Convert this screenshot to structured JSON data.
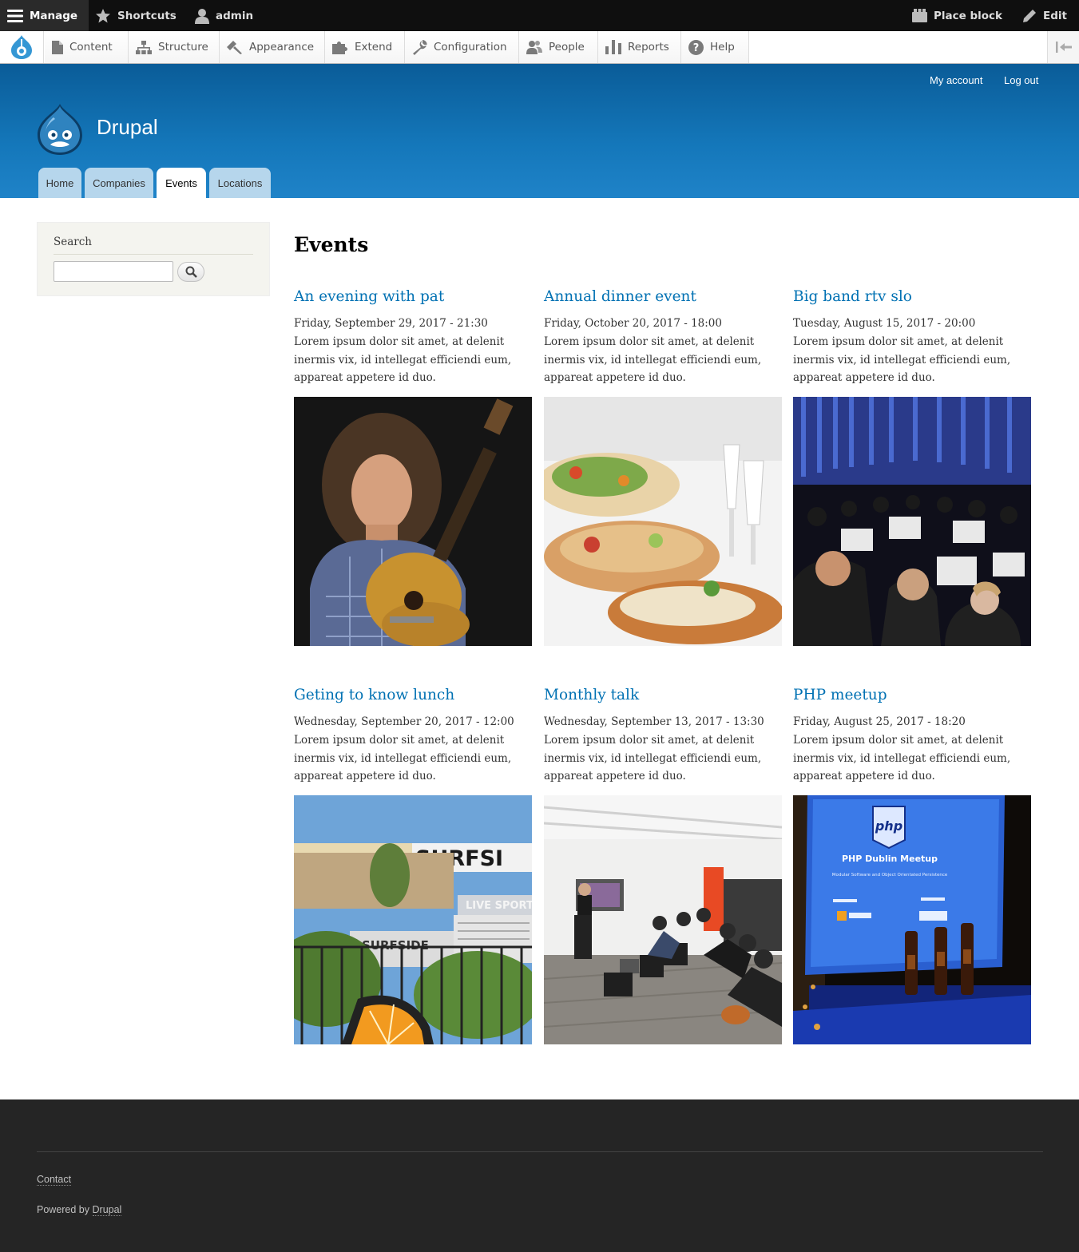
{
  "toolbar": {
    "manage": "Manage",
    "shortcuts": "Shortcuts",
    "user": "admin",
    "place_block": "Place block",
    "edit": "Edit"
  },
  "tray": {
    "items": [
      {
        "label": "Content",
        "icon": "file-icon"
      },
      {
        "label": "Structure",
        "icon": "sitemap-icon"
      },
      {
        "label": "Appearance",
        "icon": "brush-icon"
      },
      {
        "label": "Extend",
        "icon": "puzzle-icon"
      },
      {
        "label": "Configuration",
        "icon": "wrench-icon"
      },
      {
        "label": "People",
        "icon": "people-icon"
      },
      {
        "label": "Reports",
        "icon": "bar-chart-icon"
      },
      {
        "label": "Help",
        "icon": "help-icon"
      }
    ]
  },
  "header": {
    "secondary_menu": [
      "My account",
      "Log out"
    ],
    "site_name": "Drupal",
    "tabs": [
      "Home",
      "Companies",
      "Events",
      "Locations"
    ],
    "active_tab": "Events"
  },
  "sidebar": {
    "search_title": "Search",
    "search_value": ""
  },
  "main": {
    "title": "Events",
    "events": [
      {
        "title": "An evening with pat",
        "date": "Friday, September 29, 2017 - 21:30",
        "body": "Lorem ipsum dolor sit amet, at delenit inermis vix, id intellegat efficiendi eum, appareat appetere id duo.",
        "image": "guitarist-photo"
      },
      {
        "title": "Annual dinner event",
        "date": "Friday, October 20, 2017 - 18:00",
        "body": "Lorem ipsum dolor sit amet, at delenit inermis vix, id intellegat efficiendi eum, appareat appetere id duo.",
        "image": "banquet-photo"
      },
      {
        "title": "Big band rtv slo",
        "date": "Tuesday, August 15, 2017 - 20:00",
        "body": "Lorem ipsum dolor sit amet, at delenit inermis vix, id intellegat efficiendi eum, appareat appetere id duo.",
        "image": "orchestra-photo"
      },
      {
        "title": "Geting to know lunch",
        "date": "Wednesday, September 20, 2017 - 12:00",
        "body": "Lorem ipsum dolor sit amet, at delenit inermis vix, id intellegat efficiendi eum, appareat appetere id duo.",
        "image": "surfside-photo"
      },
      {
        "title": "Monthly talk",
        "date": "Wednesday, September 13, 2017 - 13:30",
        "body": "Lorem ipsum dolor sit amet, at delenit inermis vix, id intellegat efficiendi eum, appareat appetere id duo.",
        "image": "talk-photo"
      },
      {
        "title": "PHP meetup",
        "date": "Friday, August 25, 2017 - 18:20",
        "body": "Lorem ipsum dolor sit amet, at delenit inermis vix, id intellegat efficiendi eum, appareat appetere id duo.",
        "image": "php-meetup-photo"
      }
    ],
    "image_text": {
      "surfside_sign": "SURFSI",
      "surfside_live": "LIVE SPORT",
      "surfside_lower": "SURFSIDE",
      "php_logo": "php",
      "php_heading": "PHP Dublin Meetup",
      "php_sub": "Modular Software and Object Orientated Persistence"
    }
  },
  "footer": {
    "contact": "Contact",
    "powered_prefix": "Powered by",
    "powered_link": "Drupal"
  },
  "colors": {
    "link": "#0071b3",
    "header_top": "#0a5c98",
    "header_bottom": "#1f83c8",
    "tab_inactive": "#b6d6ec",
    "footer_bg": "#252525",
    "toolbar_bg": "#0f0f0f"
  }
}
